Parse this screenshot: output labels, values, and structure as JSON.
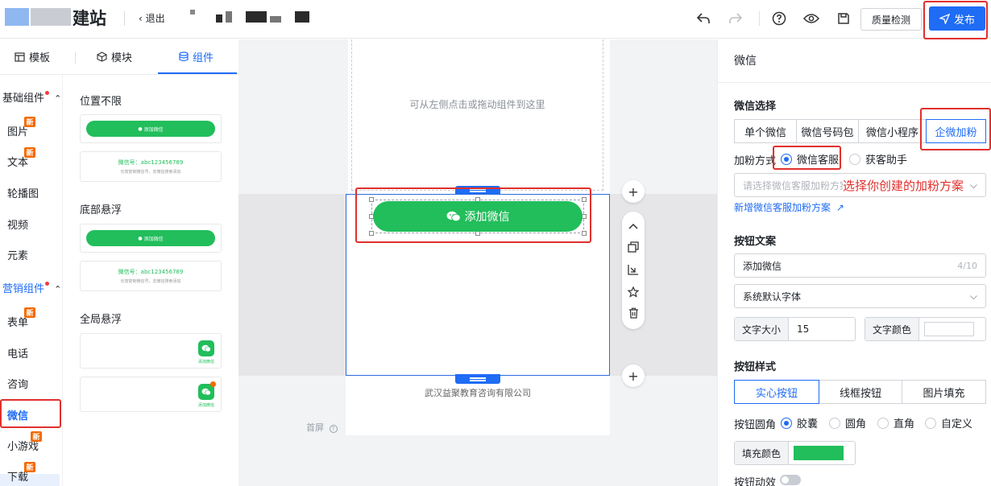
{
  "header": {
    "title": "建站",
    "exit_label": "退出",
    "quality_label": "质量检测",
    "publish_label": "发布"
  },
  "left_tabs": [
    {
      "label": "模板",
      "icon": "layout-icon"
    },
    {
      "label": "模块",
      "icon": "cube-icon"
    },
    {
      "label": "组件",
      "icon": "database-icon",
      "active": true
    }
  ],
  "categories": {
    "basic_group": "基础组件",
    "basic_items": [
      "图片",
      "文本",
      "轮播图",
      "视频",
      "元素"
    ],
    "marketing_group": "营销组件",
    "marketing_items": [
      "表单",
      "电话",
      "咨询",
      "微信",
      "小游戏",
      "下载"
    ],
    "new_badge": "新"
  },
  "components": {
    "section1": "位置不限",
    "section2": "底部悬浮",
    "section3": "全局悬浮",
    "mini_button_label": "添加微信",
    "wechat_id_line": "微信号：abc123456789",
    "wechat_id_sub": "长按复制微信号，去微信搜索添加",
    "float_label": "添加微信"
  },
  "canvas": {
    "hint": "可从左侧点击或拖动组件到这里",
    "button_label": "添加微信",
    "company": "武汉益聚教育咨询有限公司",
    "first_screen": "首屏"
  },
  "panel": {
    "title": "微信",
    "wechat_select_title": "微信选择",
    "wechat_select_options": [
      "单个微信",
      "微信号码包",
      "微信小程序",
      "企微加粉"
    ],
    "fans_method_label": "加粉方式",
    "fans_options": [
      "微信客服",
      "获客助手"
    ],
    "plan_placeholder": "请选择微信客服加粉方案",
    "annotation": "选择你创建的加粉方案",
    "new_plan_link": "新增微信客服加粉方案",
    "button_text_title": "按钮文案",
    "button_text_value": "添加微信",
    "button_text_count": "4/10",
    "font_value": "系统默认字体",
    "font_size_label": "文字大小",
    "font_size_value": "15",
    "text_color_label": "文字颜色",
    "button_style_title": "按钮样式",
    "button_style_options": [
      "实心按钮",
      "线框按钮",
      "图片填充"
    ],
    "corner_label": "按钮圆角",
    "corner_options": [
      "胶囊",
      "圆角",
      "直角",
      "自定义"
    ],
    "fill_color_label": "填充颜色",
    "animation_label": "按钮动效"
  },
  "colors": {
    "accent": "#1f6cf5",
    "wechat_green": "#21be5b",
    "annotation_red": "#e0302d"
  }
}
